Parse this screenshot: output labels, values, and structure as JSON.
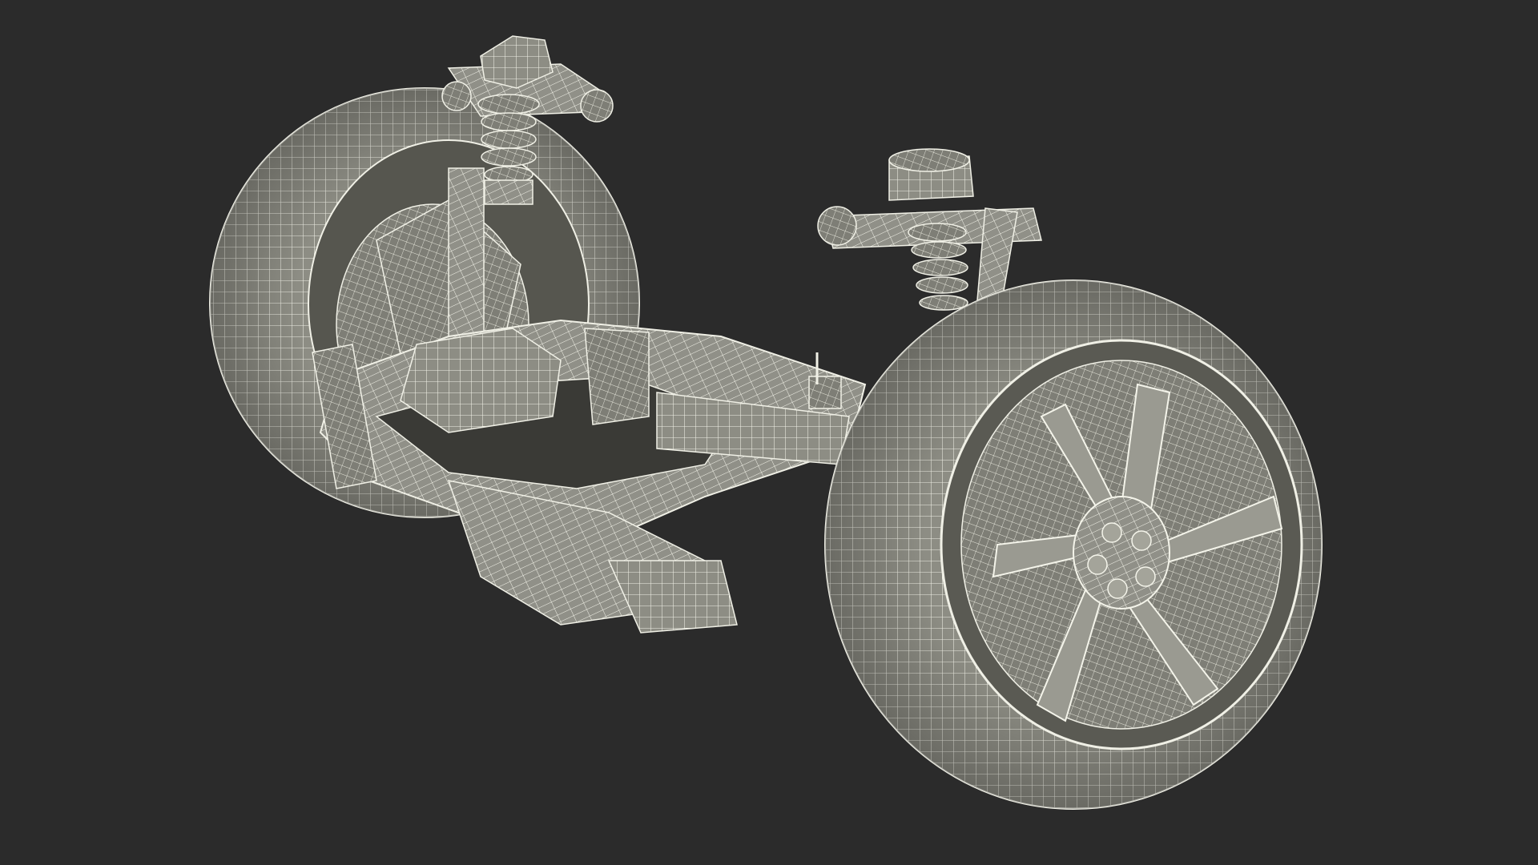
{
  "scene": {
    "background_color": "#2b2b2b",
    "model_fill_color": "#8f8f86",
    "model_shade_color": "#6e6e67",
    "wire_color": "#f2f2e8"
  }
}
